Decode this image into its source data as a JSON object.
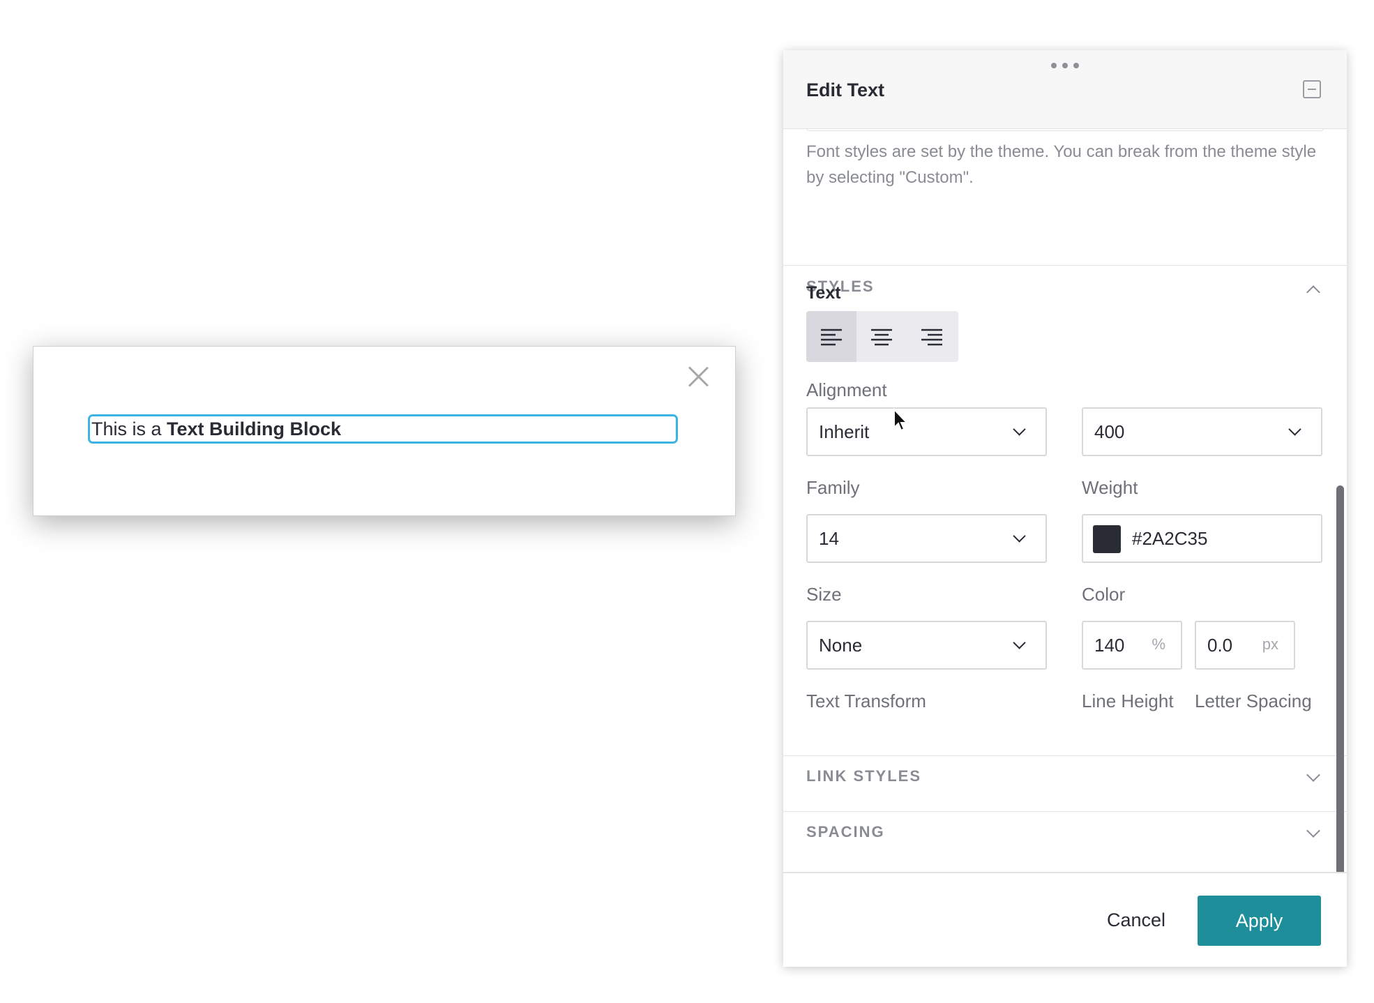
{
  "preview": {
    "text_normal": "This is a ",
    "text_bold": "Text Building Block"
  },
  "panel": {
    "title": "Edit Text",
    "help_text": "Font styles are set by the theme. You can break from the theme style by selecting \"Custom\".",
    "styles_section": {
      "label": "STYLES",
      "subtitle": "Text",
      "alignment_label": "Alignment",
      "alignment_options": [
        "align-left",
        "align-center",
        "align-right"
      ],
      "alignment_selected": "align-left",
      "family": {
        "value": "Inherit",
        "label": "Family"
      },
      "weight": {
        "value": "400",
        "label": "Weight"
      },
      "size": {
        "value": "14",
        "label": "Size"
      },
      "color": {
        "value": "#2A2C35",
        "label": "Color",
        "swatch": "#2A2C35"
      },
      "text_transform": {
        "value": "None",
        "label": "Text Transform"
      },
      "line_height": {
        "value": "140",
        "unit": "%",
        "label": "Line Height"
      },
      "letter_spacing": {
        "value": "0.0",
        "unit": "px",
        "label": "Letter Spacing"
      }
    },
    "link_styles_section": {
      "label": "LINK STYLES"
    },
    "spacing_section": {
      "label": "SPACING"
    },
    "footer": {
      "cancel_label": "Cancel",
      "apply_label": "Apply"
    }
  },
  "colors": {
    "accent": "#1F8E9B",
    "focus": "#3BB4E4",
    "text": "#2A2C35",
    "muted": "#8A8C93"
  }
}
